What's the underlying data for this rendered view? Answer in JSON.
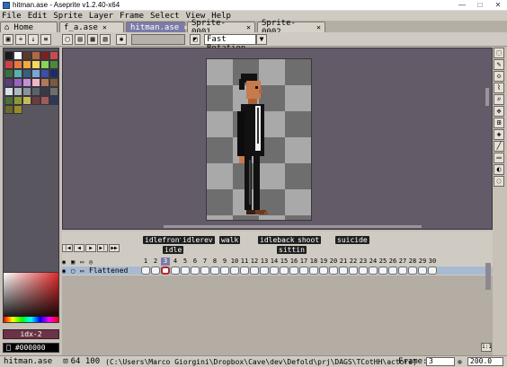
{
  "window": {
    "title": "hitman.ase - Aseprite v1.2.40-x64",
    "controls": [
      "—",
      "□",
      "✕"
    ]
  },
  "menu": [
    "File",
    "Edit",
    "Sprite",
    "Layer",
    "Frame",
    "Select",
    "View",
    "Help"
  ],
  "tabs": [
    {
      "label": "Home",
      "icon": "home-icon"
    },
    {
      "label": "f_a.ase",
      "close": "✕"
    },
    {
      "label": "hitman.ase",
      "close": "✕"
    },
    {
      "label": "Sprite-0001",
      "close": "✕"
    },
    {
      "label": "Sprite-0002",
      "close": "✕"
    }
  ],
  "toolbar": {
    "rotation_mode": "Fast Rotation",
    "rotation_arrow": "▼"
  },
  "palette": {
    "colors": [
      "#1a1a1a",
      "#ffffff",
      "#5c3a2a",
      "#b06a42",
      "#7f1f1f",
      "#c94b4b",
      "#d34040",
      "#e87a3f",
      "#f2a83a",
      "#f5d75d",
      "#8bd159",
      "#4a8a3a",
      "#3d6f3b",
      "#5ab0b0",
      "#3a5f7d",
      "#7aa7d9",
      "#3950a8",
      "#1c2b6a",
      "#5a3d7a",
      "#9a62c0",
      "#c58fd8",
      "#f2b6c7",
      "#b07a5a",
      "#7a5a3a",
      "#d8e0e8",
      "#b0b8c0",
      "#8a929a",
      "#5a626a",
      "#3a3a46",
      "#6e6e6e",
      "#4b6e3a",
      "#8a9a3a",
      "#c4b85a",
      "#6a3e3e",
      "#a05a5a",
      "#2a3a5a",
      "#6a6a2a",
      "#9a8a2a"
    ],
    "index_label": "idx-2",
    "hex_value": "#000000",
    "primary_color": "#000000"
  },
  "timeline": {
    "tags": [
      "idlefront",
      "idlerev",
      "walk",
      "idleback",
      "shoot",
      "suicide",
      "idle",
      "sittin"
    ],
    "frame_numbers": [
      "1",
      "2",
      "3",
      "4",
      "5",
      "6",
      "7",
      "8",
      "9",
      "10",
      "11",
      "12",
      "13",
      "14",
      "15",
      "16",
      "17",
      "18",
      "19",
      "20",
      "21",
      "22",
      "23",
      "24",
      "25",
      "26",
      "27",
      "28",
      "29",
      "30"
    ],
    "layer_name": "Flattened"
  },
  "status": {
    "file": "hitman.ase",
    "size": "64 100",
    "path": "(C:\\Users\\Marco Giorgini\\Dropbox\\Cave\\dev\\Defold\\prj\\DAGS\\TCotHH\\actors)",
    "frame_label": "Frame:",
    "frame_value": "3",
    "zoom_value": "200.0"
  }
}
